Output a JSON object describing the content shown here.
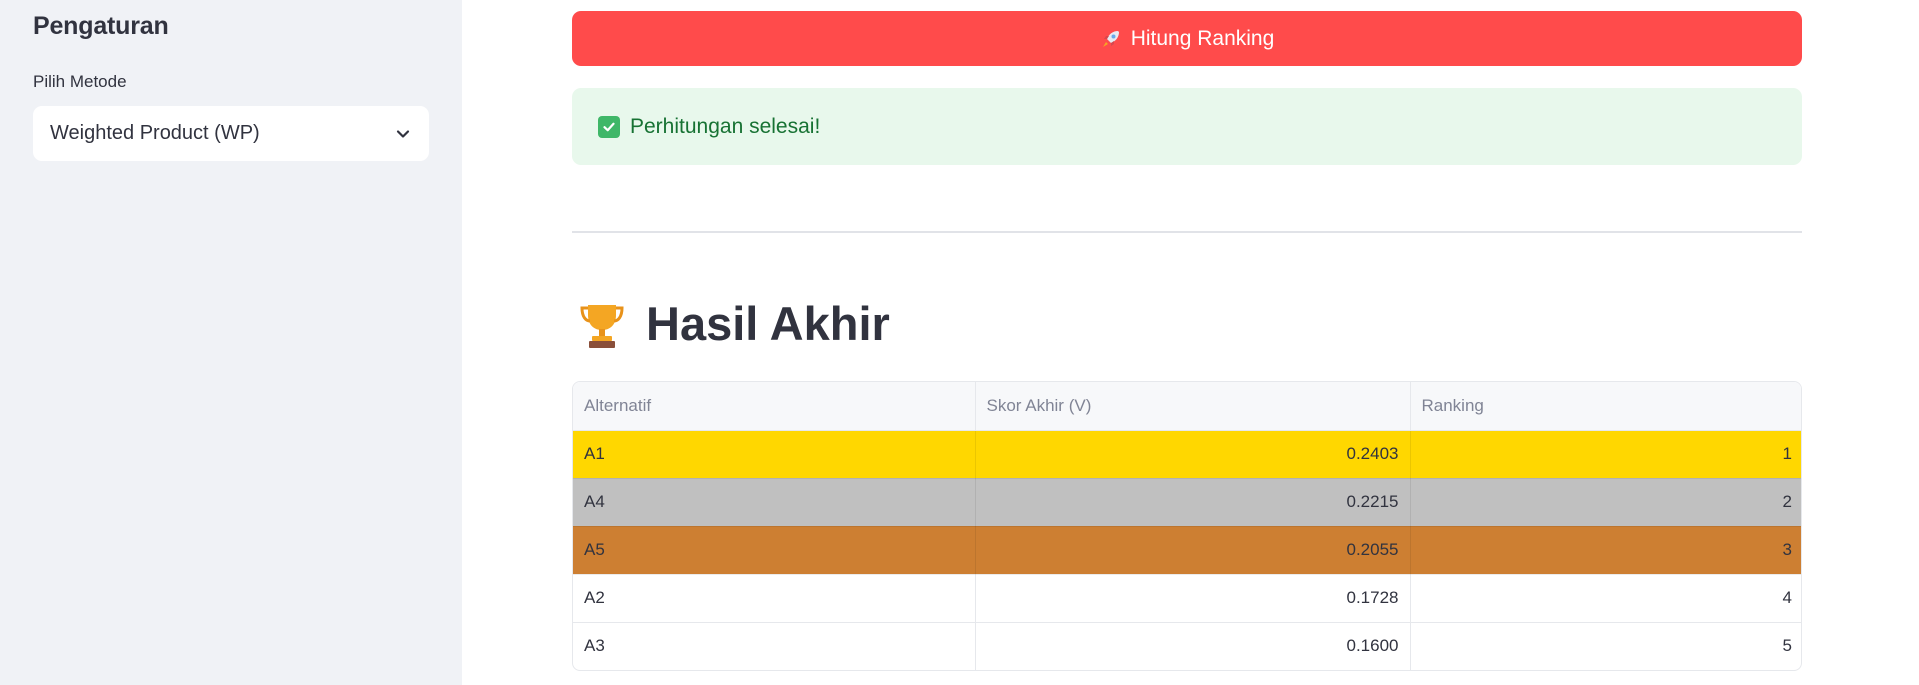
{
  "sidebar": {
    "title": "Pengaturan",
    "method_label": "Pilih Metode",
    "method_value": "Weighted Product (WP)"
  },
  "main": {
    "button_label": "Hitung Ranking",
    "button_icon": "rocket-icon",
    "success_message": "Perhitungan selesai!",
    "success_icon": "check-box-icon",
    "heading": "Hasil Akhir",
    "heading_icon": "trophy-icon"
  },
  "table": {
    "columns": [
      "Alternatif",
      "Skor Akhir (V)",
      "Ranking"
    ],
    "rows": [
      {
        "alternatif": "A1",
        "skor": "0.2403",
        "ranking": "1"
      },
      {
        "alternatif": "A4",
        "skor": "0.2215",
        "ranking": "2"
      },
      {
        "alternatif": "A5",
        "skor": "0.2055",
        "ranking": "3"
      },
      {
        "alternatif": "A2",
        "skor": "0.1728",
        "ranking": "4"
      },
      {
        "alternatif": "A3",
        "skor": "0.1600",
        "ranking": "5"
      }
    ]
  },
  "colors": {
    "primary": "#ff4b4b",
    "success_bg": "#e8f8ec",
    "success_text": "#177233",
    "gold": "#ffd700",
    "silver": "#c0c0c0",
    "bronze": "#cd7f32"
  }
}
